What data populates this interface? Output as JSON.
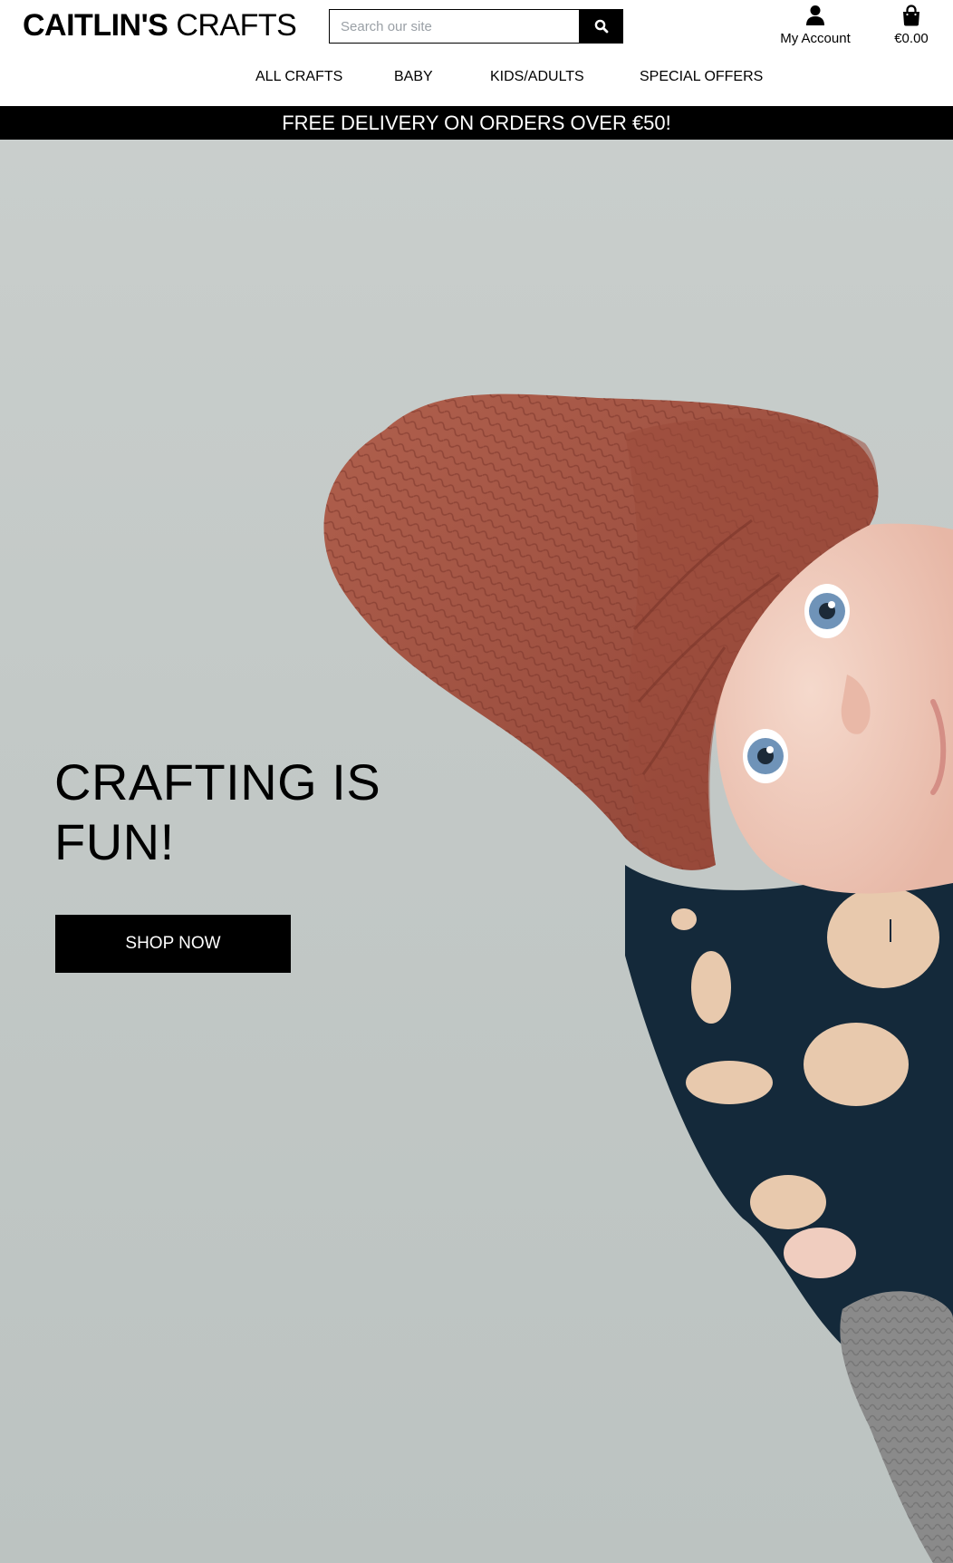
{
  "header": {
    "logo_bold": "CAITLIN'S",
    "logo_light": "CRAFTS",
    "search_placeholder": "Search our site",
    "search_icon": "search-icon",
    "account_label": "My Account",
    "account_icon": "user-icon",
    "bag_total": "€0.00",
    "bag_icon": "shopping-bag-icon"
  },
  "nav": {
    "items": [
      {
        "label": "ALL CRAFTS"
      },
      {
        "label": "BABY"
      },
      {
        "label": "KIDS/ADULTS"
      },
      {
        "label": "SPECIAL OFFERS"
      }
    ]
  },
  "banner": {
    "text": "FREE DELIVERY ON ORDERS OVER €50!"
  },
  "hero": {
    "title": "CRAFTING IS FUN!",
    "cta_label": "SHOP NOW"
  },
  "colors": {
    "accent": "#000000",
    "background": "#ffffff",
    "hero_bg": "#c3c9c7",
    "hat": "#a4503f",
    "shirt": "#14293a"
  }
}
